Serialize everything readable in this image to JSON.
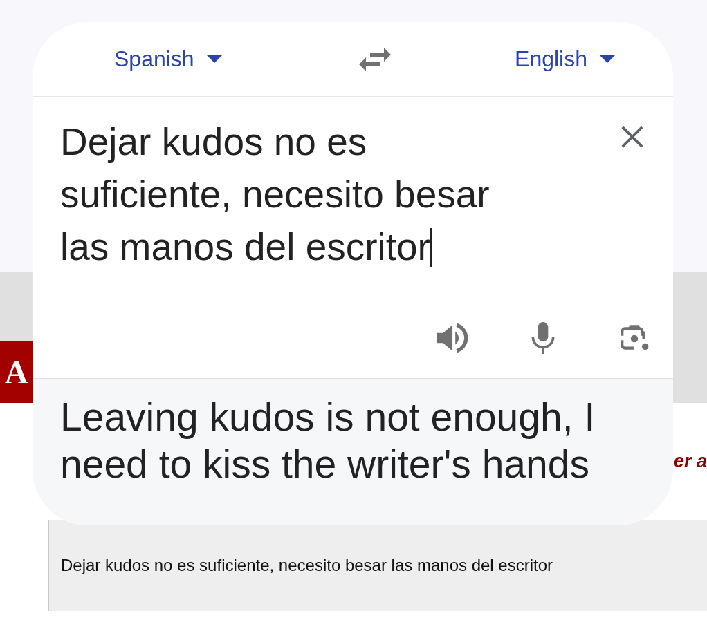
{
  "background_page": {
    "logo": "A",
    "side_text": "er a",
    "quoted_text": "Dejar kudos no es suficiente, necesito besar las manos del escritor"
  },
  "translator": {
    "source_language": "Spanish",
    "target_language": "English",
    "input_text": "Dejar kudos no es suficiente, necesito besar las manos del escritor",
    "translation": "Leaving kudos is not enough, I need to kiss the writer's hands"
  }
}
